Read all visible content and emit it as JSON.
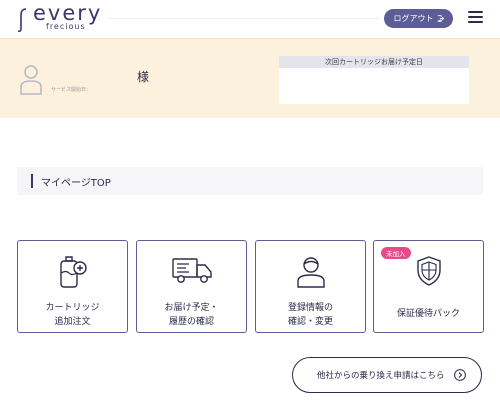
{
  "header": {
    "logo_word": "every",
    "logo_sub": "frecious",
    "logout_label": "ログアウト",
    "logout_icon": "logout-arrow-icon",
    "menu_icon": "hamburger-menu-icon"
  },
  "user": {
    "avatar_icon": "person-icon",
    "service_start_label": "サービス開始日：",
    "honorific": "様",
    "next_delivery_label": "次回カートリッジお届け予定日",
    "next_delivery_value": ""
  },
  "section": {
    "title": "マイページTOP"
  },
  "cards": [
    {
      "icon": "cartridge-add-icon",
      "lines": [
        "カートリッジ",
        "追加注文"
      ]
    },
    {
      "icon": "delivery-truck-icon",
      "lines": [
        "お届け予定・",
        "履歴の確認"
      ]
    },
    {
      "icon": "user-profile-icon",
      "lines": [
        "登録情報の",
        "確認・変更"
      ]
    },
    {
      "icon": "shield-icon",
      "lines": [
        "保証優待パック"
      ],
      "badge": "未加入"
    }
  ],
  "switch_link": {
    "label": "他社からの乗り換え申請はこちら",
    "icon": "chevron-right-circle-icon"
  },
  "colors": {
    "brand": "#3a3768",
    "button": "#5e5c96",
    "band": "#fbf1dc",
    "badge": "#e8498a"
  }
}
